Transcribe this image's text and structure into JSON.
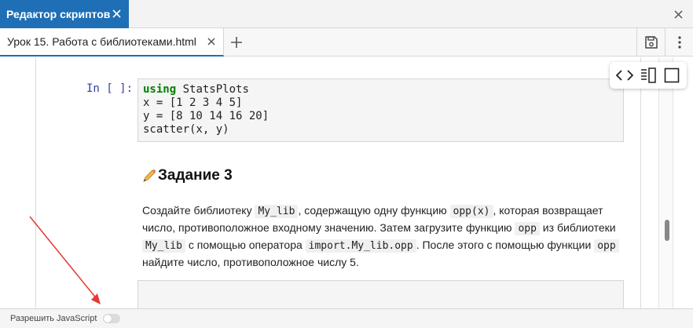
{
  "panel": {
    "title": "Редактор скриптов",
    "close_icon": "close-icon",
    "accent_color": "#1e6fb5"
  },
  "file_tab": {
    "title": "Урок 15. Работа с библиотеками.html",
    "close_icon": "close-icon",
    "add_icon": "plus-icon"
  },
  "actions": {
    "save_icon": "save-icon",
    "more_icon": "more-vertical-icon"
  },
  "view_toolbar": [
    "code-view-icon",
    "split-view-icon",
    "single-view-icon"
  ],
  "code_cell": {
    "prompt": "In [ ]:",
    "keyword": "using",
    "line1_rest": " StatsPlots",
    "line2": "x = [1 2 3 4 5]",
    "line3": "y = [8 10 14 16 20]",
    "line4": "scatter(x, y)",
    "keyword_color": "#008000"
  },
  "markdown": {
    "heading": "Задание 3",
    "heading_icon": "pencil-icon",
    "p1": "Создайте библиотеку ",
    "c1": "My_lib",
    "p2": ", содержащую одну функцию ",
    "c2": "opp(x)",
    "p3": ", которая возвращает число, противоположное входному значению. Затем загрузите функцию ",
    "c3": "opp",
    "p4": " из библиотеки ",
    "c4": "My_lib",
    "p5": " с помощью оператора ",
    "c5": "import.My_lib.opp",
    "p6": ". После этого с помощью функции ",
    "c6": "opp",
    "p7": " найдите число, противоположное числу 5."
  },
  "footer": {
    "label": "Разрешить JavaScript",
    "toggle_state": "off"
  },
  "annotation": {
    "arrow_color": "#e53935"
  }
}
